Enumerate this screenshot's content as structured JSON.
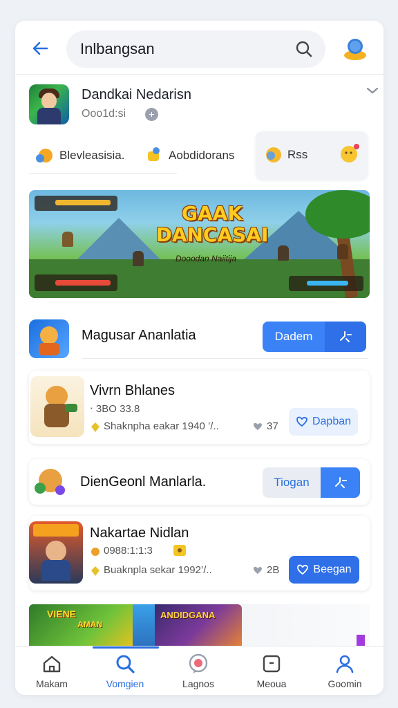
{
  "header": {
    "search_value": "Inlbangsan",
    "back_label": "back"
  },
  "profile": {
    "name": "Dandkai Nedarisn",
    "subtitle": "Ooo1d:si",
    "plus": "+"
  },
  "chips": [
    {
      "label": "Blevleasisia."
    },
    {
      "label": "Aobdidorans"
    },
    {
      "label": "Rss"
    }
  ],
  "banner": {
    "title": "GAAK DANCASAI",
    "subtitle": "Dooodan Naiitija"
  },
  "items": [
    {
      "title": "Magusar Ananlatia",
      "action": "Dadem"
    },
    {
      "title": "Vivrn Bhlanes",
      "stats": "‧ 3BO 33.8",
      "meta": "Shaknpha eakar 1940 ’/..",
      "rating": "37",
      "action": "Dapban"
    },
    {
      "title": "DienGeonl Manlarla.",
      "action": "Tiogan"
    },
    {
      "title": "Nakartae Nidlan",
      "stats": "0988:1:1:3",
      "meta": "Buaknpla sekar 1992’/..",
      "rating": "2B",
      "action": "Beegan"
    }
  ],
  "promo": {
    "left_text": "VIENE",
    "left_sub": "AMAN",
    "right_text": "ANDIDGANA"
  },
  "tabs": [
    {
      "label": "Makam",
      "icon": "home-icon"
    },
    {
      "label": "Vomgien",
      "icon": "search-icon"
    },
    {
      "label": "Lagnos",
      "icon": "chat-icon"
    },
    {
      "label": "Meoua",
      "icon": "inbox-icon"
    },
    {
      "label": "Goomin",
      "icon": "profile-icon"
    }
  ],
  "colors": {
    "accent": "#2a6fe0",
    "button_blue": "#3b82f6",
    "button_light": "#e8f1fd"
  }
}
